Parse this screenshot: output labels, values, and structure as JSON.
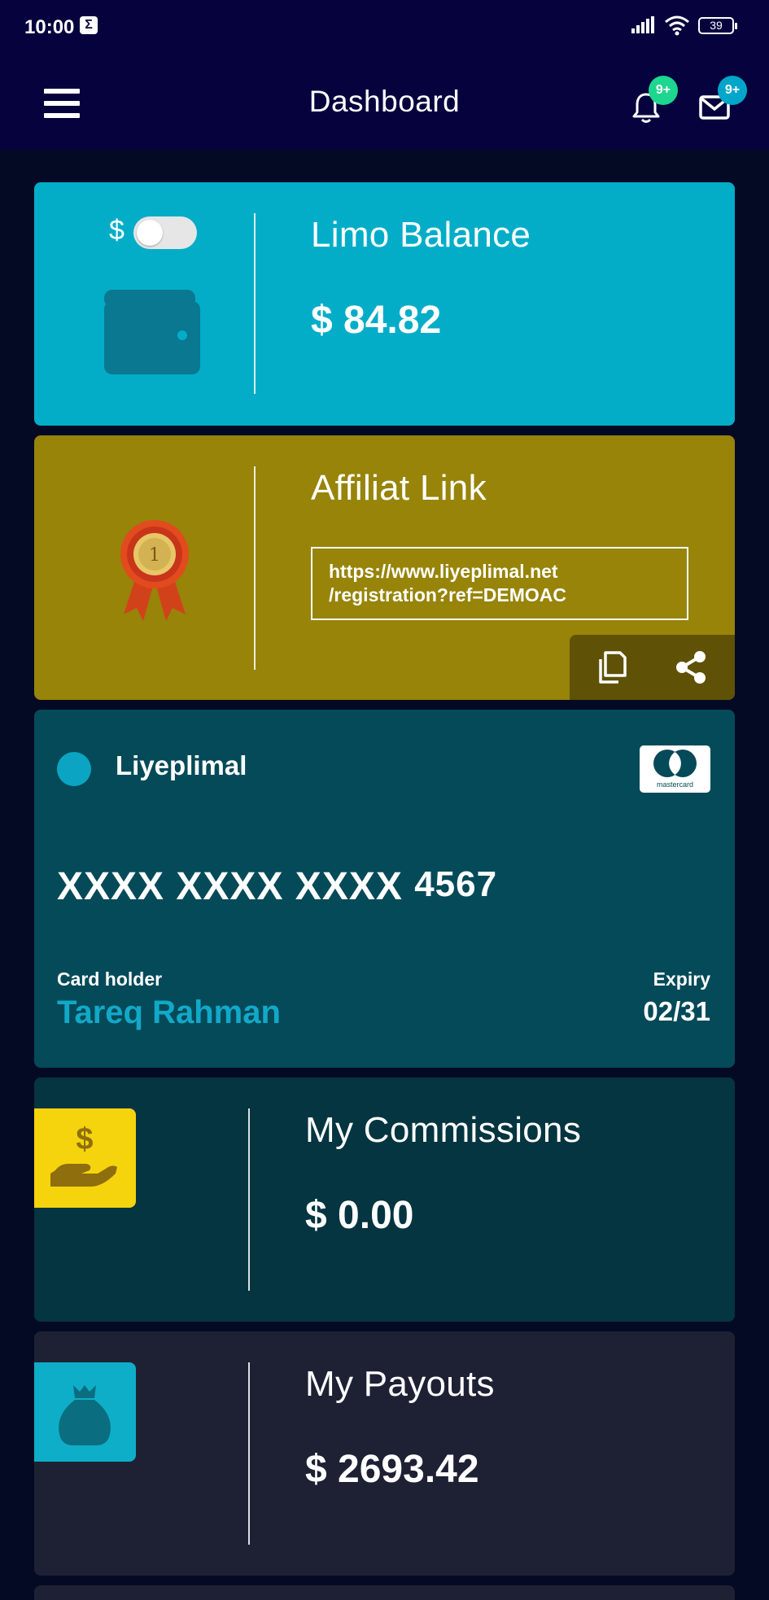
{
  "status_bar": {
    "time": "10:00",
    "notification_glyph": "Σ",
    "battery": "39"
  },
  "app_bar": {
    "title": "Dashboard",
    "notification_badge": "9+",
    "message_badge": "9+"
  },
  "balance_card": {
    "currency_symbol": "$",
    "title": "Limo Balance",
    "amount": "$ 84.82",
    "toggle_on": false,
    "color": "#03adc8"
  },
  "affiliate_card": {
    "title": "Affiliat Link",
    "link_line1": "https://www.liyeplimal.net",
    "link_line2": "/registration?ref=DEMOAC",
    "color": "#978409"
  },
  "credit_card": {
    "brand": "Liyeplimal",
    "network": "mastercard",
    "number_masked": "XXXX XXXX XXXX",
    "number_last4": "4567",
    "holder_label": "Card holder",
    "holder_name": "Tareq Rahman",
    "expiry_label": "Expiry",
    "expiry_value": "02/31",
    "color": "#054a59"
  },
  "commissions_card": {
    "title": "My Commissions",
    "amount": "$ 0.00",
    "icon": "hand-dollar-icon",
    "color": "#043540"
  },
  "payouts_card": {
    "title": "My Payouts",
    "amount": "$ 2693.42",
    "icon": "money-bag-icon",
    "color": "#1e2134"
  }
}
